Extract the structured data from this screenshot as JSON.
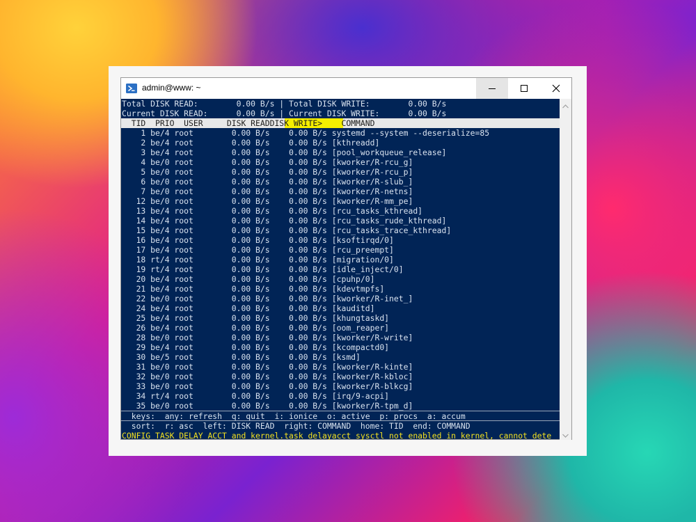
{
  "window": {
    "title": "admin@www: ~"
  },
  "summary": {
    "line1": "Total DISK READ:        0.00 B/s | Total DISK WRITE:        0.00 B/s",
    "line2": "Current DISK READ:      0.00 B/s | Current DISK WRITE:      0.00 B/s"
  },
  "header": {
    "pre": "  TID  PRIO  USER     DISK READ",
    "highlighted": "DISK WRITE>",
    "post": "    COMMAND"
  },
  "rows": [
    "    1 be/4 root        0.00 B/s    0.00 B/s systemd --system --deserialize=85",
    "    2 be/4 root        0.00 B/s    0.00 B/s [kthreadd]",
    "    3 be/4 root        0.00 B/s    0.00 B/s [pool_workqueue_release]",
    "    4 be/0 root        0.00 B/s    0.00 B/s [kworker/R-rcu_g]",
    "    5 be/0 root        0.00 B/s    0.00 B/s [kworker/R-rcu_p]",
    "    6 be/0 root        0.00 B/s    0.00 B/s [kworker/R-slub_]",
    "    7 be/0 root        0.00 B/s    0.00 B/s [kworker/R-netns]",
    "   12 be/0 root        0.00 B/s    0.00 B/s [kworker/R-mm_pe]",
    "   13 be/4 root        0.00 B/s    0.00 B/s [rcu_tasks_kthread]",
    "   14 be/4 root        0.00 B/s    0.00 B/s [rcu_tasks_rude_kthread]",
    "   15 be/4 root        0.00 B/s    0.00 B/s [rcu_tasks_trace_kthread]",
    "   16 be/4 root        0.00 B/s    0.00 B/s [ksoftirqd/0]",
    "   17 be/4 root        0.00 B/s    0.00 B/s [rcu_preempt]",
    "   18 rt/4 root        0.00 B/s    0.00 B/s [migration/0]",
    "   19 rt/4 root        0.00 B/s    0.00 B/s [idle_inject/0]",
    "   20 be/4 root        0.00 B/s    0.00 B/s [cpuhp/0]",
    "   21 be/4 root        0.00 B/s    0.00 B/s [kdevtmpfs]",
    "   22 be/0 root        0.00 B/s    0.00 B/s [kworker/R-inet_]",
    "   24 be/4 root        0.00 B/s    0.00 B/s [kauditd]",
    "   25 be/4 root        0.00 B/s    0.00 B/s [khungtaskd]",
    "   26 be/4 root        0.00 B/s    0.00 B/s [oom_reaper]",
    "   28 be/0 root        0.00 B/s    0.00 B/s [kworker/R-write]",
    "   29 be/4 root        0.00 B/s    0.00 B/s [kcompactd0]",
    "   30 be/5 root        0.00 B/s    0.00 B/s [ksmd]",
    "   31 be/0 root        0.00 B/s    0.00 B/s [kworker/R-kinte]",
    "   32 be/0 root        0.00 B/s    0.00 B/s [kworker/R-kbloc]",
    "   33 be/0 root        0.00 B/s    0.00 B/s [kworker/R-blkcg]",
    "   34 rt/4 root        0.00 B/s    0.00 B/s [irq/9-acpi]",
    "   35 be/0 root        0.00 B/s    0.00 B/s [kworker/R-tpm_d]"
  ],
  "keys_line": "  keys:  any: refresh  q: quit  i: ionice  o: active  p: procs  a: accum",
  "sort_line": "  sort:  r: asc  left: DISK READ  right: COMMAND  home: TID  end: COMMAND",
  "warning": "CONFIG_TASK_DELAY_ACCT and kernel.task_delayacct sysctl not enabled in kernel, cannot dete",
  "colors": {
    "terminal_bg": "#012456",
    "terminal_text": "#d9e2ef",
    "header_bg": "#e8e8e8",
    "highlight": "#f4ee00",
    "warning": "#f3e020"
  },
  "icons": {
    "app": "powershell-icon",
    "minimize": "minimize-icon",
    "maximize": "maximize-icon",
    "close": "close-icon"
  }
}
